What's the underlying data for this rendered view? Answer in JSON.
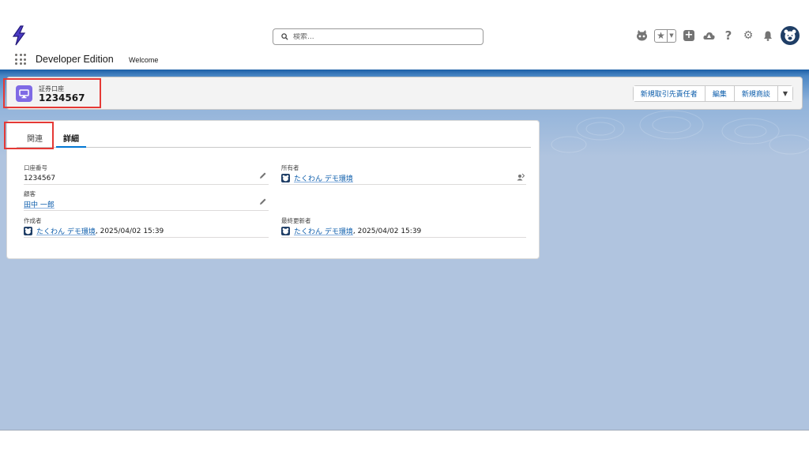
{
  "header": {
    "search_placeholder": "検索...",
    "app_name": "Developer Edition",
    "nav_welcome": "Welcome"
  },
  "record": {
    "object_type": "証券口座",
    "name": "1234567",
    "actions": [
      "新規取引先責任者",
      "編集",
      "新規商談"
    ],
    "icon_color": "#7f6ae5"
  },
  "tabs": {
    "related": "関連",
    "details": "詳細"
  },
  "fields": {
    "account_number": {
      "label": "口座番号",
      "value": "1234567"
    },
    "owner": {
      "label": "所有者",
      "value": "たくわん デモ環境"
    },
    "customer": {
      "label": "顧客",
      "value": "田中 一郎"
    },
    "created_by": {
      "label": "作成者",
      "value": "たくわん デモ環境",
      "timestamp": ", 2025/04/02 15:39"
    },
    "last_modified_by": {
      "label": "最終更新者",
      "value": "たくわん デモ環境",
      "timestamp": ", 2025/04/02 15:39"
    }
  },
  "colors": {
    "brand_blue": "#0176d3",
    "link": "#0b5cab",
    "highlight_red": "#e53935",
    "background": "#b0c4df"
  }
}
